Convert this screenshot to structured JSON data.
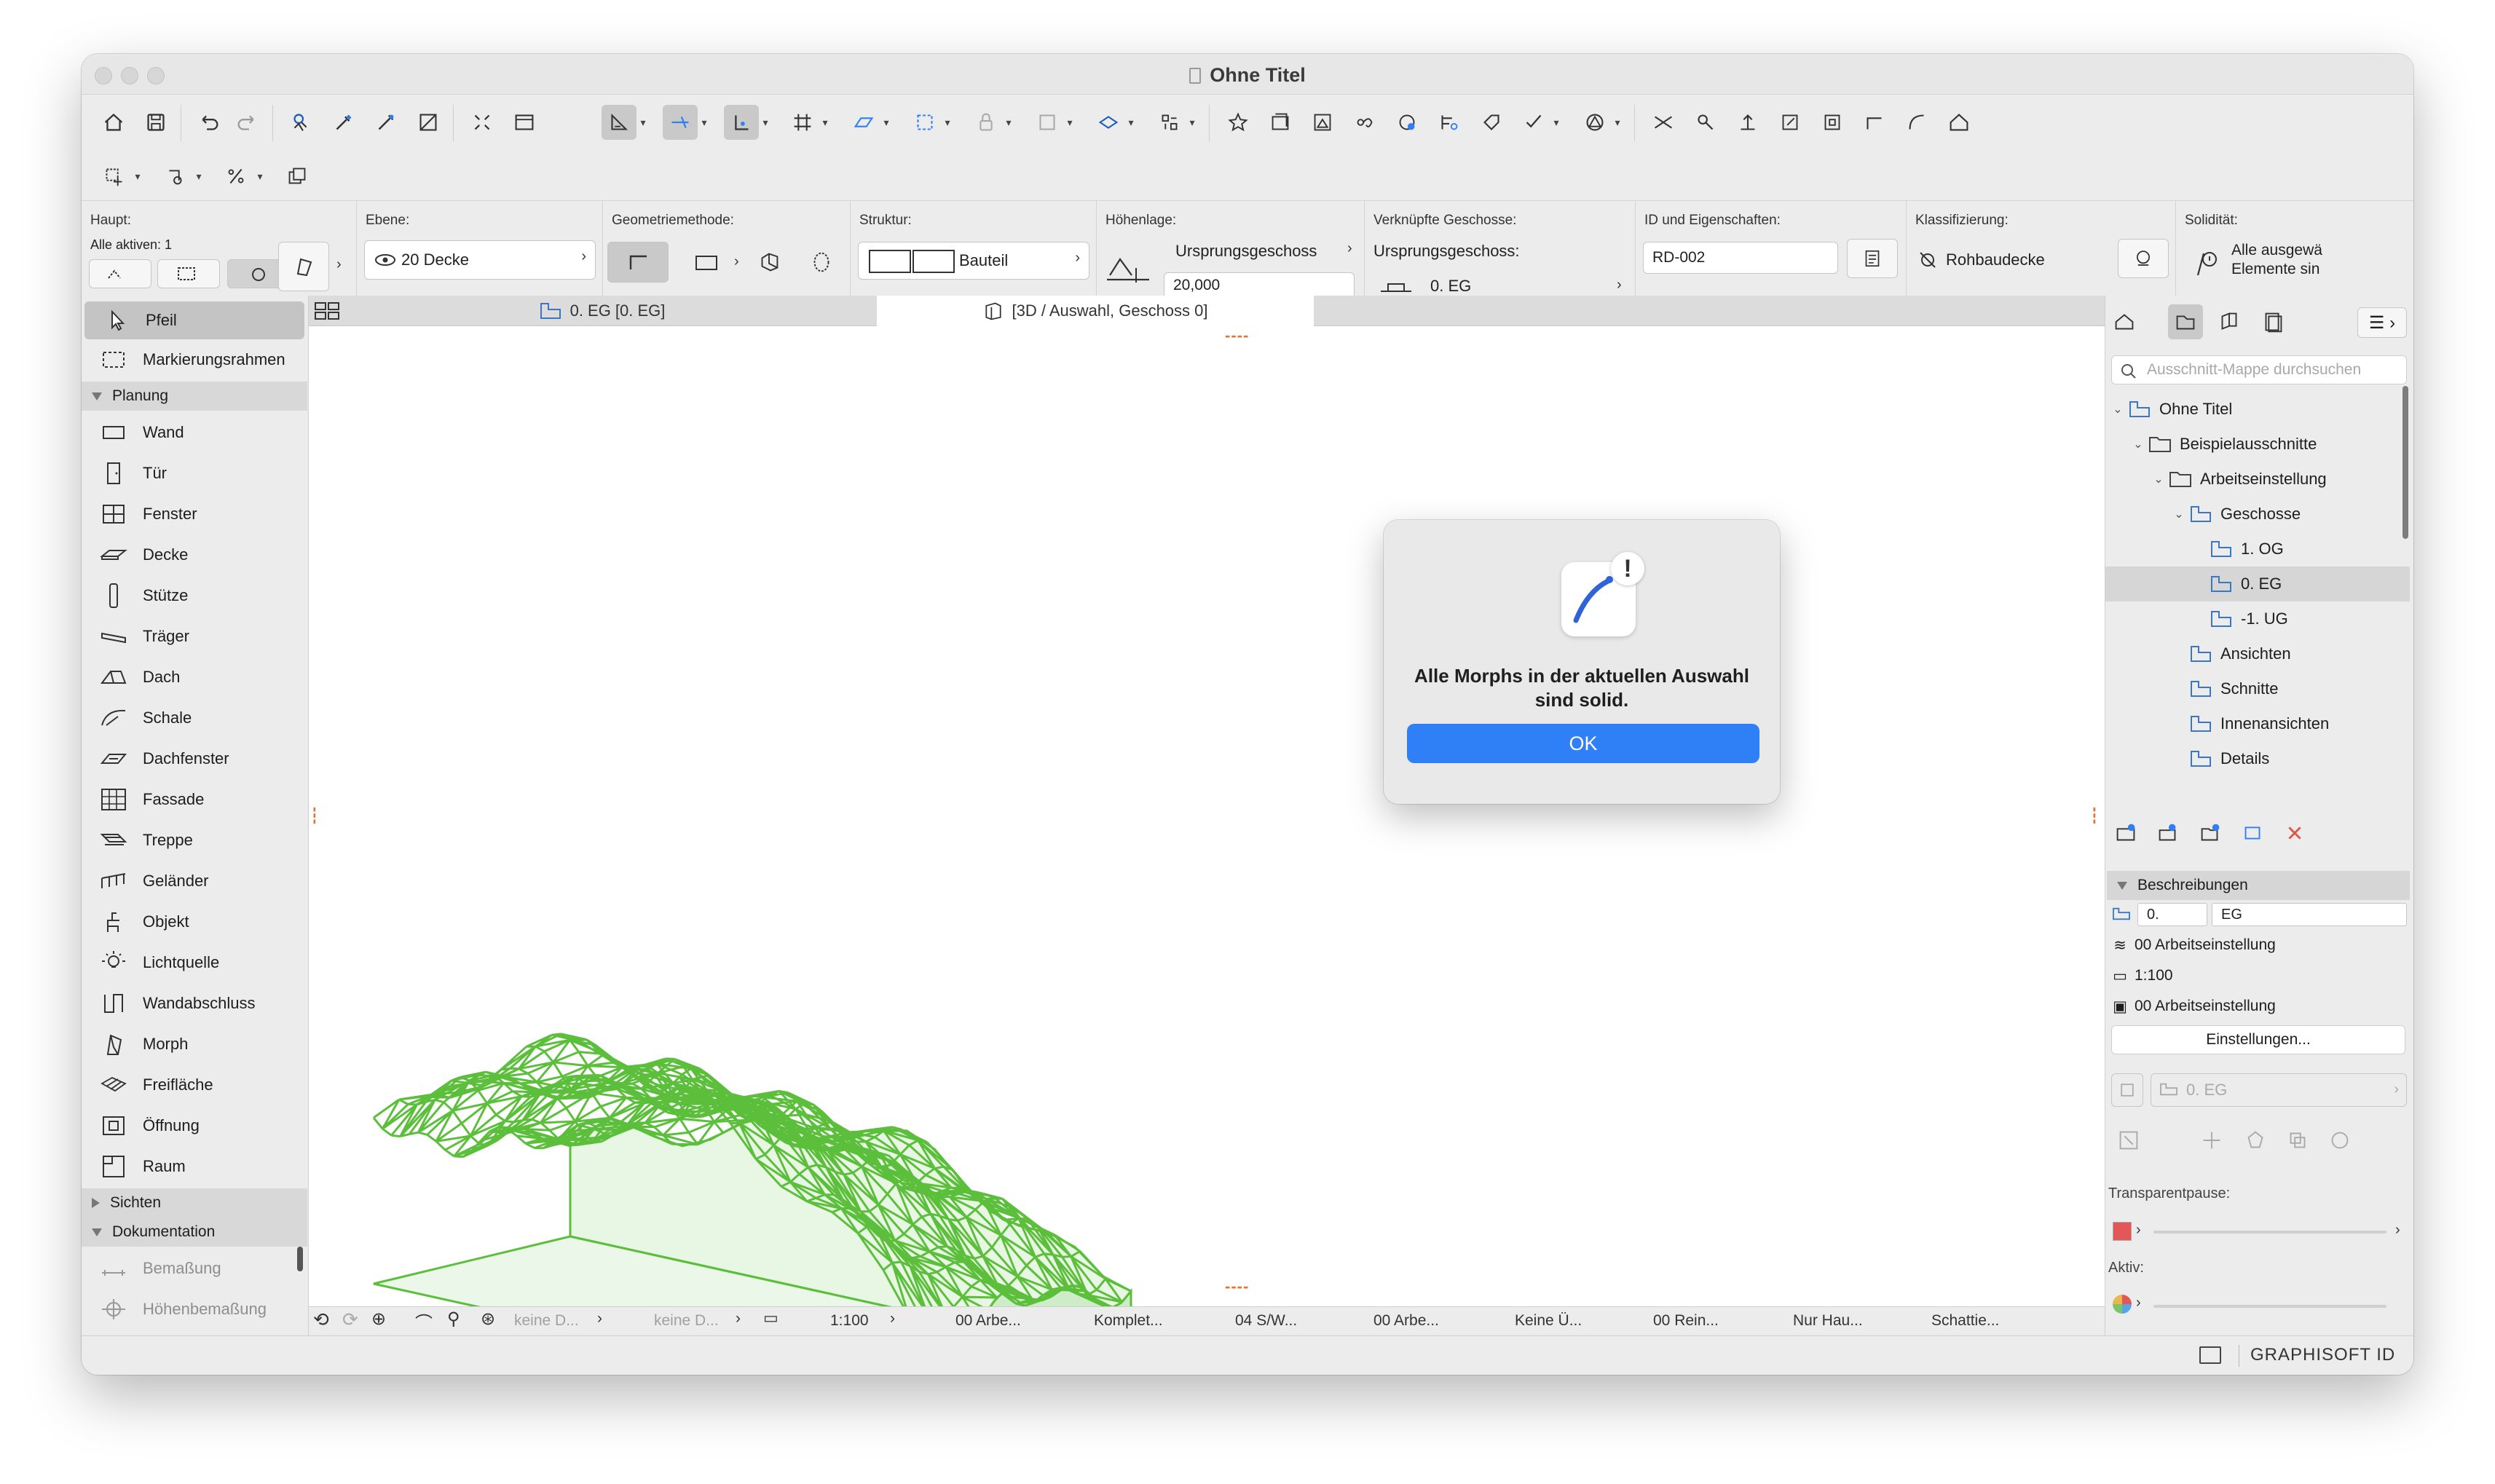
{
  "window": {
    "title": "Ohne Titel"
  },
  "infobox": {
    "haupt_label": "Haupt:",
    "alle_aktiven": "Alle aktiven: 1",
    "ebene_label": "Ebene:",
    "ebene_value": "20 Decke",
    "geometrie_label": "Geometriemethode:",
    "struktur_label": "Struktur:",
    "struktur_value": "Bauteil",
    "hoehenlage_label": "Höhenlage:",
    "ursprungsgeschoss": "Ursprungsgeschoss",
    "hoehe_value": "20,000",
    "verknuepfte_label": "Verknüpfte Geschosse:",
    "verknuepfte_sub": "Ursprungsgeschoss:",
    "verknuepfte_value": "0. EG",
    "id_label": "ID und Eigenschaften:",
    "id_value": "RD-002",
    "klass_label": "Klassifizierung:",
    "klass_value": "Rohbaudecke",
    "solid_label": "Solidität:",
    "solid_value_1": "Alle ausgewä",
    "solid_value_2": "Elemente sin"
  },
  "toolbox": {
    "arrow": "Pfeil",
    "marquee": "Markierungsrahmen",
    "cat_planung": "Planung",
    "tools": [
      "Wand",
      "Tür",
      "Fenster",
      "Decke",
      "Stütze",
      "Träger",
      "Dach",
      "Schale",
      "Dachfenster",
      "Fassade",
      "Treppe",
      "Geländer",
      "Objekt",
      "Lichtquelle",
      "Wandabschluss",
      "Morph",
      "Freifläche",
      "Öffnung",
      "Raum"
    ],
    "cat_sichten": "Sichten",
    "cat_doku": "Dokumentation",
    "doku_tools": [
      "Bemaßung",
      "Höhenbemaßung"
    ]
  },
  "tabs": {
    "floorplan": "0. EG [0. EG]",
    "view3d": "[3D / Auswahl, Geschoss 0]"
  },
  "dialog": {
    "message_line1": "Alle Morphs in der aktuellen Auswahl",
    "message_line2": "sind solid.",
    "ok": "OK"
  },
  "statusbar": {
    "keine1": "keine D...",
    "keine2": "keine D...",
    "scale": "1:100",
    "arbe1": "00 Arbe...",
    "komplet": "Komplet...",
    "sw": "04 S/W...",
    "arbe2": "00 Arbe...",
    "keine_ue": "Keine Ü...",
    "rein": "00 Rein...",
    "nurhau": "Nur Hau...",
    "schattie": "Schattie..."
  },
  "navigator": {
    "search_placeholder": "Ausschnitt-Mappe durchsuchen",
    "tree": [
      {
        "label": "Ohne Titel",
        "depth": 0,
        "chev": "v"
      },
      {
        "label": "Beispielausschnitte",
        "depth": 1,
        "chev": "v"
      },
      {
        "label": "Arbeitseinstellung",
        "depth": 2,
        "chev": "v"
      },
      {
        "label": "Geschosse",
        "depth": 3,
        "chev": "v"
      },
      {
        "label": "1. OG",
        "depth": 4,
        "chev": ""
      },
      {
        "label": "0. EG",
        "depth": 4,
        "chev": ""
      },
      {
        "label": "-1. UG",
        "depth": 4,
        "chev": ""
      },
      {
        "label": "Ansichten",
        "depth": 3,
        "chev": ""
      },
      {
        "label": "Schnitte",
        "depth": 3,
        "chev": ""
      },
      {
        "label": "Innenansichten",
        "depth": 3,
        "chev": ""
      },
      {
        "label": "Details",
        "depth": 3,
        "chev": ""
      }
    ],
    "beschreibungen": "Beschreibungen",
    "id_num": "0.",
    "id_name": "EG",
    "layer_combo": "00 Arbeitseinstellung",
    "scale": "1:100",
    "model_view": "00 Arbeitseinstellung",
    "einstellungen": "Einstellungen...",
    "ref_view": "0. EG",
    "transparentpause": "Transparentpause:",
    "aktiv": "Aktiv:"
  },
  "footer": {
    "brand": "GRAPHISOFT ID"
  },
  "colors": {
    "morph_green": "#5cbf3c",
    "accent_blue": "#2f7ff6",
    "selected_grey": "#c4c4c4"
  }
}
